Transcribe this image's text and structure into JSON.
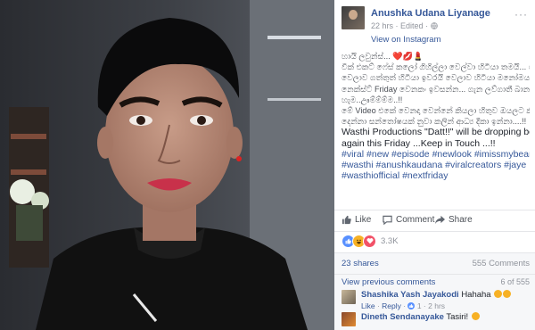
{
  "post": {
    "author": "Anushka Udana Liyanage",
    "time": "22 hrs",
    "edited": "Edited",
    "separator": "·",
    "view_on_instagram": "View on Instagram",
    "text_lines": [
      "හායි ලවුන්ස්... ❤️💋💄",
      "වීක් එකට් ෆේස් කලෝ ගිහිල්ලා වෙල්වා හිටියා තමයි... මේ",
      "වෙලාව ගත්තුත් හිටියා ඉවරයි වෙලාව හිටියා මනෝමය",
      "නෙක්ස්ට් Friday වෙනකං ඉවසන්න... ගැන ලව්ගාතී බාන",
      "හැම..ඌම්ම්ම්ම..!!",
      "මේ Video එකේ වෙනදා වෙන්නේ කියලා හිතුව ඔයලට කියලා",
      "දෙන්නා සන්තෝෂයක් නුවා කලින් ආධ්‍ය දීකා ඉන්නා....!!"
    ],
    "english_line_1": "Wasthi Productions \"Datt!!\" will be dropping bombs",
    "english_line_2": "again this Friday ...Keep in Touch ...!!",
    "hashtags_line_1": "#viral #new #episode #newlook #imissmybeard",
    "hashtags_line_2": "#wasthi #anushkaudana #viralcreators #jaye",
    "hashtags_line_3": "#wasthiofficial #nextfriday"
  },
  "actions": {
    "like": "Like",
    "comment": "Comment",
    "share": "Share"
  },
  "reactions": {
    "count": "3.3K",
    "types": [
      "like-reaction-icon",
      "haha-reaction-icon",
      "love-reaction-icon"
    ]
  },
  "stats": {
    "shares": "23 shares",
    "comments": "555 Comments"
  },
  "comments_section": {
    "view_previous": "View previous comments",
    "range": "6 of 555",
    "items": [
      {
        "name": "Shashika Yash Jayakodi",
        "text": "Hahaha",
        "like": "Like",
        "reply": "Reply",
        "reactions": "1",
        "time": "2 hrs"
      },
      {
        "name": "Dineth Sendanayake",
        "text": "Tasiri!"
      }
    ]
  },
  "colors": {
    "link": "#365899",
    "muted": "#90949c",
    "background_dark": "#000000"
  }
}
